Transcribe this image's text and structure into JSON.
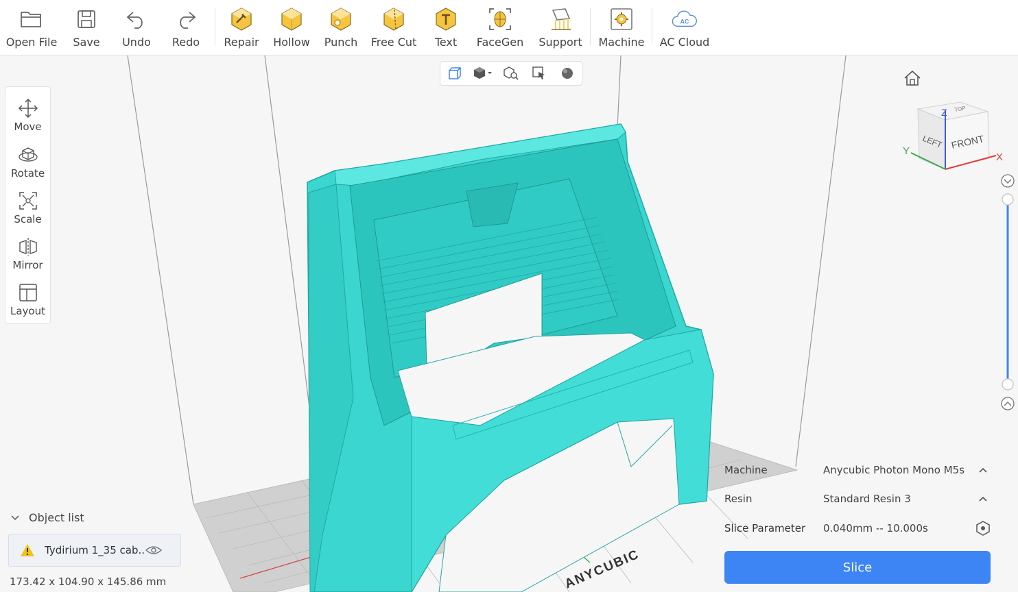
{
  "toolbar": {
    "open_file": "Open File",
    "save": "Save",
    "undo": "Undo",
    "redo": "Redo",
    "repair": "Repair",
    "hollow": "Hollow",
    "punch": "Punch",
    "free_cut": "Free Cut",
    "text": "Text",
    "facegen": "FaceGen",
    "support": "Support",
    "machine": "Machine",
    "ac_cloud": "AC Cloud",
    "ac_cloud_badge": "AC",
    "accent_color": "#f5c542"
  },
  "view_modes": [
    "view-3d-icon",
    "view-solid-icon",
    "view-search-icon",
    "view-select-icon",
    "view-sphere-icon"
  ],
  "transform_tools": {
    "move": "Move",
    "rotate": "Rotate",
    "scale": "Scale",
    "mirror": "Mirror",
    "layout": "Layout"
  },
  "view_cube": {
    "top": "TOP",
    "left": "LEFT",
    "front": "FRONT",
    "axis_x": "X",
    "axis_y": "Y",
    "axis_z": "Z"
  },
  "build_plate": {
    "brand": "ANYCUBIC"
  },
  "object_list": {
    "title": "Object list",
    "item_name": "Tydirium 1_35 cab...",
    "dimensions": "173.42 x 104.90 x 145.86 mm"
  },
  "settings": {
    "machine_label": "Machine",
    "machine_value": "Anycubic Photon Mono M5s",
    "resin_label": "Resin",
    "resin_value": "Standard Resin 3",
    "slice_param_label": "Slice Parameter",
    "slice_param_value": "0.040mm -- 10.000s"
  },
  "slice_button": "Slice",
  "colors": {
    "model": "#3ad6cf",
    "primary": "#3d85f4",
    "warning": "#f2c21b"
  }
}
